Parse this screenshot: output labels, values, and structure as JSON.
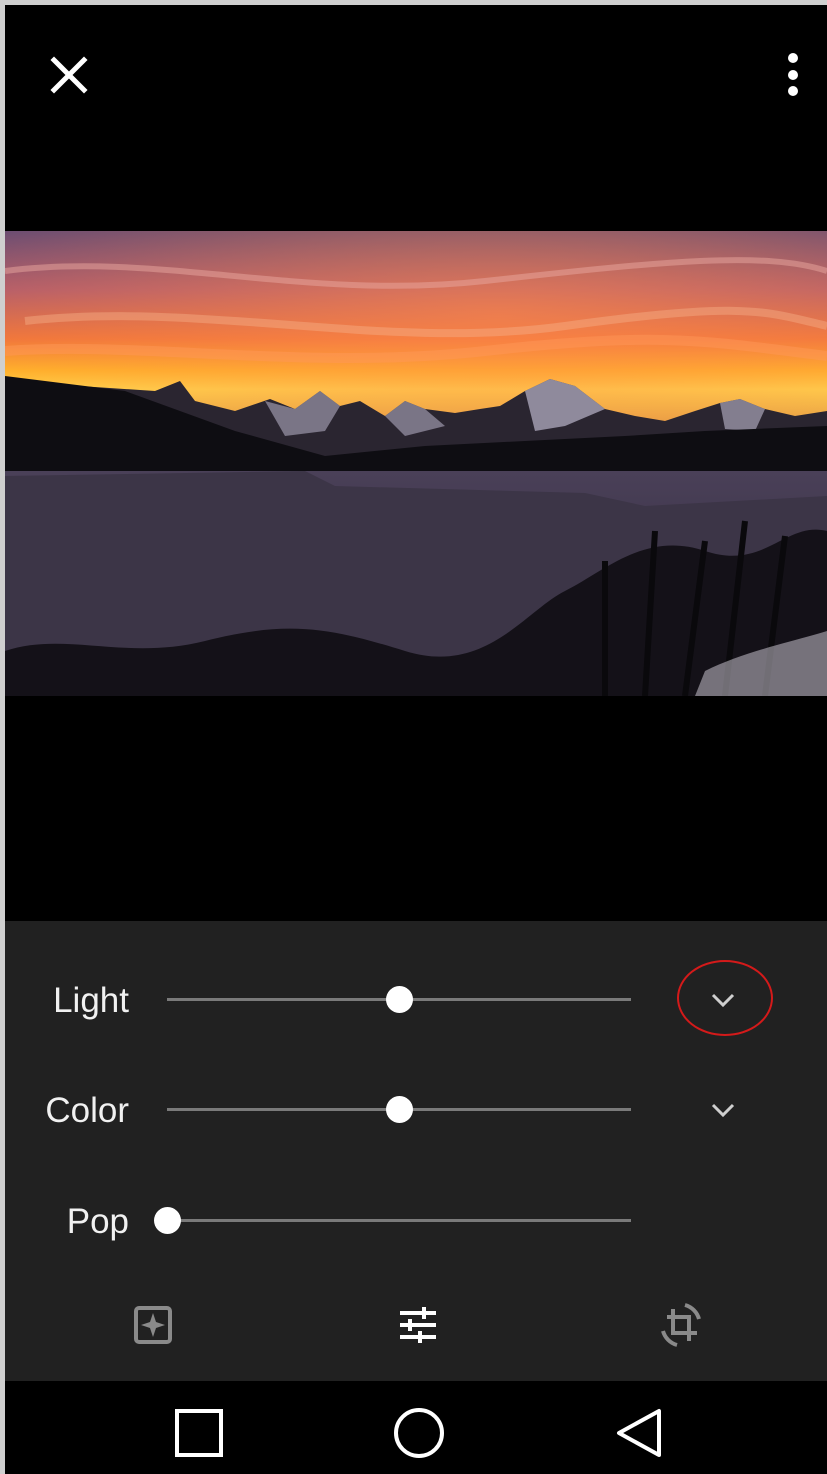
{
  "top_bar": {
    "close_icon": "close-icon",
    "more_icon": "more-vertical-icon"
  },
  "photo": {
    "description_icon": "landscape-photo"
  },
  "adjustments": [
    {
      "label": "Light",
      "value": 0.5,
      "has_expand": true,
      "expand_icon": "chevron-down-icon"
    },
    {
      "label": "Color",
      "value": 0.5,
      "has_expand": true,
      "expand_icon": "chevron-down-icon"
    },
    {
      "label": "Pop",
      "value": 0.0,
      "has_expand": false
    }
  ],
  "highlight": {
    "color": "#d41a1a",
    "target": "light-expand"
  },
  "tools": [
    {
      "name": "auto-enhance",
      "icon": "auto-enhance-icon"
    },
    {
      "name": "adjust",
      "icon": "sliders-icon",
      "active": true
    },
    {
      "name": "crop-rotate",
      "icon": "crop-rotate-icon"
    }
  ],
  "nav": {
    "recent_icon": "square-icon",
    "home_icon": "circle-icon",
    "back_icon": "triangle-back-icon"
  },
  "colors": {
    "panel_bg": "#212121",
    "track": "#7a7a7a",
    "thumb": "#ffffff",
    "text": "#f1f1f1"
  }
}
